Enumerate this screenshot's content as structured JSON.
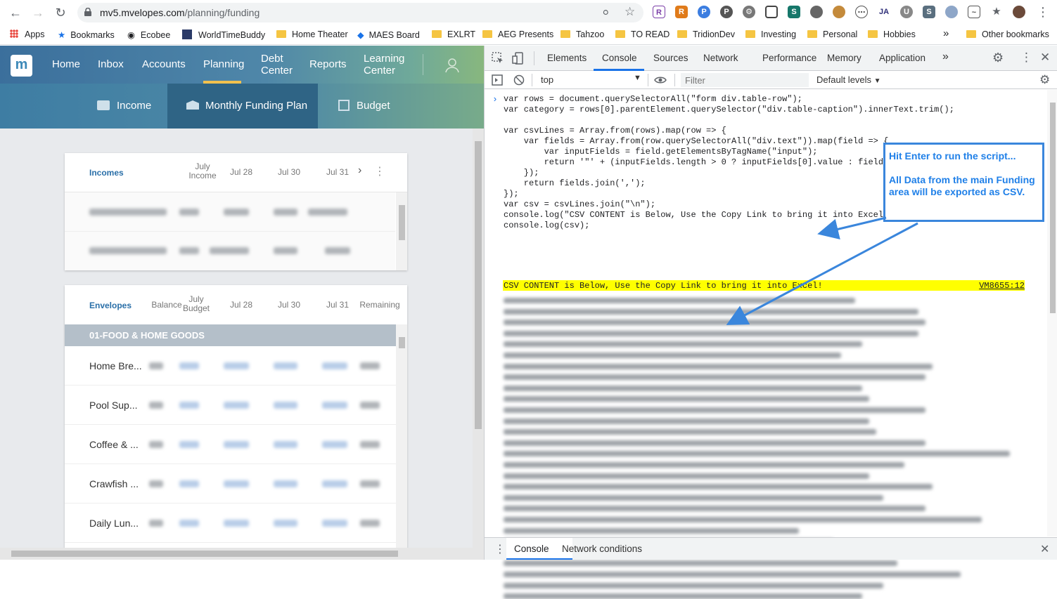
{
  "browser": {
    "url_host": "mv5.mvelopes.com",
    "url_path": "/planning/funding",
    "bookmarks": [
      "Apps",
      "Bookmarks",
      "Ecobee",
      "WorldTimeBuddy",
      "Home Theater",
      "MAES Board",
      "EXLRT",
      "AEG Presents",
      "Tahzoo",
      "TO READ",
      "TridionDev",
      "Investing",
      "Personal",
      "Hobbies"
    ],
    "other_bookmarks": "Other bookmarks",
    "overflow": "»"
  },
  "app": {
    "logo": "m",
    "nav": {
      "home": "Home",
      "inbox": "Inbox",
      "accounts": "Accounts",
      "planning": "Planning",
      "debt": "Debt",
      "debt2": "Center",
      "reports": "Reports",
      "learning": "Learning",
      "learning2": "Center"
    },
    "subnav": {
      "income": "Income",
      "funding": "Monthly Funding Plan",
      "budget": "Budget"
    },
    "incomes": {
      "title": "Incomes",
      "col_july_1": "July",
      "col_july_2": "Income",
      "col_jul28": "Jul 28",
      "col_jul30": "Jul 30",
      "col_jul31": "Jul 31"
    },
    "envelopes": {
      "title": "Envelopes",
      "col_balance": "Balance",
      "col_budget_1": "July",
      "col_budget_2": "Budget",
      "col_jul28": "Jul 28",
      "col_jul30": "Jul 30",
      "col_jul31": "Jul 31",
      "col_remaining": "Remaining",
      "category": "01-FOOD & HOME GOODS",
      "rows": [
        "Home Bre...",
        "Pool Sup...",
        "Coffee & ...",
        "Crawfish ...",
        "Daily Lun..."
      ]
    }
  },
  "devtools": {
    "tabs": [
      "Elements",
      "Console",
      "Sources",
      "Network",
      "Performance",
      "Memory",
      "Application"
    ],
    "more": "»",
    "context": "top",
    "filter_placeholder": "Filter",
    "levels": "Default levels",
    "code_lines": [
      "var rows = document.querySelectorAll(\"form div.table-row\");",
      "var category = rows[0].parentElement.querySelector(\"div.table-caption\").innerText.trim();",
      "",
      "var csvLines = Array.from(rows).map(row => {",
      "    var fields = Array.from(row.querySelectorAll(\"div.text\")).map(field => {",
      "        var inputFields = field.getElementsByTagName(\"input\");",
      "        return '\"' + (inputFields.length > 0 ? inputFields[0].value : field",
      "    });",
      "    return fields.join(',');",
      "});",
      "var csv = csvLines.join(\"\\n\");",
      "console.log(\"CSV CONTENT is Below, Use the Copy Link to bring it into Excel",
      "console.log(csv);"
    ],
    "log_message": "CSV CONTENT is Below, Use the Copy Link to bring it into Excel!",
    "log_source": "VM8655:12",
    "drawer_tabs": [
      "Console",
      "Network conditions"
    ]
  },
  "callout": {
    "line1": "Hit Enter to run the script...",
    "line2": "All Data from the main Funding area will be exported as CSV."
  },
  "colors": {
    "highlight": "#ffff00",
    "callout": "#3a86dc",
    "accent": "#1a73e8"
  }
}
